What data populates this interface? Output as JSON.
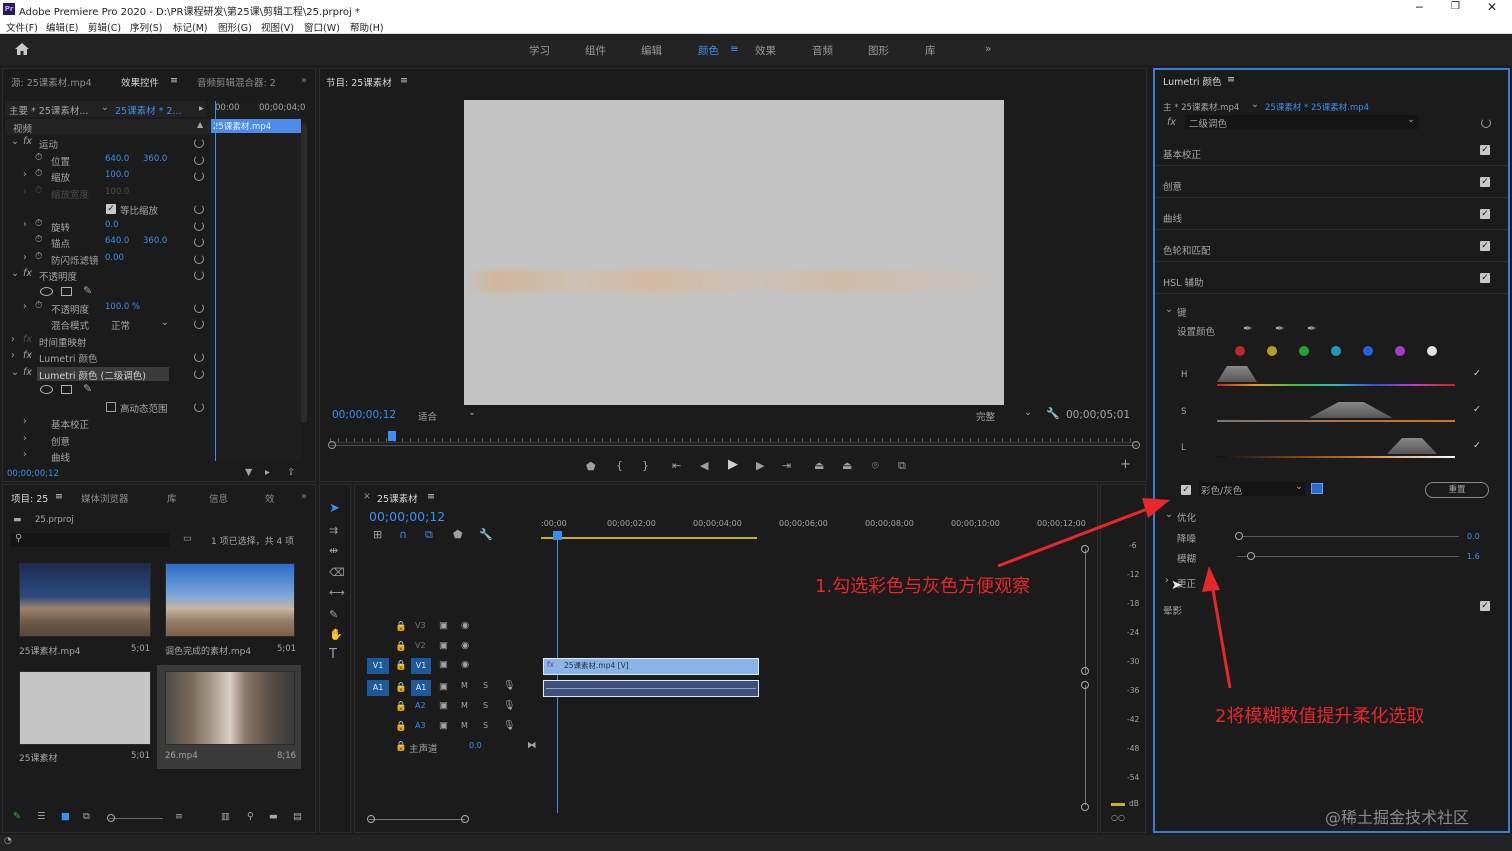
{
  "app": {
    "title": "Adobe Premiere Pro 2020 - D:\\PR课程研发\\第25课\\剪辑工程\\25.prproj *",
    "logo": "Pr"
  },
  "menu": [
    "文件(F)",
    "编辑(E)",
    "剪辑(C)",
    "序列(S)",
    "标记(M)",
    "图形(G)",
    "视图(V)",
    "窗口(W)",
    "帮助(H)"
  ],
  "workspaces": [
    "学习",
    "组件",
    "编辑",
    "颜色",
    "效果",
    "音频",
    "图形",
    "库"
  ],
  "active_workspace": "颜色",
  "effect_controls": {
    "tabs": [
      "源: 25课素材.mp4",
      "效果控件",
      "音频剪辑混合器: 2"
    ],
    "master": "主要 * 25课素材...",
    "clip": "25课素材 * 2...",
    "tc_start": "00:00",
    "tc_end": "00;00;04;0",
    "clip_label": "25课素材.mp4",
    "section_video": "视频",
    "motion": "运动",
    "position": "位置",
    "pos_x": "640.0",
    "pos_y": "360.0",
    "scale": "缩放",
    "scale_val": "100.0",
    "scale_w": "缩放宽度",
    "scale_w_val": "100.0",
    "uniform": "等比缩放",
    "rotation": "旋转",
    "rotation_val": "0.0",
    "anchor": "锚点",
    "anchor_x": "640.0",
    "anchor_y": "360.0",
    "antiflicker": "防闪烁滤镜",
    "antiflicker_val": "0.00",
    "opacity_group": "不透明度",
    "opacity": "不透明度",
    "opacity_val": "100.0 %",
    "blend": "混合模式",
    "blend_val": "正常",
    "time_remap": "时间重映射",
    "lumetri1": "Lumetri 颜色",
    "lumetri2": "Lumetri 颜色 (二级调色)",
    "hdr": "高动态范围",
    "basic": "基本校正",
    "creative": "创意",
    "curves": "曲线",
    "tc_bottom": "00;00;00;12"
  },
  "program": {
    "title": "节目: 25课素材",
    "timecode": "00;00;00;12",
    "fit": "适合",
    "quality": "完整",
    "duration": "00;00;05;01"
  },
  "project": {
    "tabs": [
      "项目: 25",
      "媒体浏览器",
      "库",
      "信息",
      "效"
    ],
    "file": "25.prproj",
    "selection": "1 项已选择，共 4 项",
    "items": [
      {
        "name": "25课素材.mp4",
        "dur": "5;01"
      },
      {
        "name": "调色完成的素材.mp4",
        "dur": "5;01"
      },
      {
        "name": "25课素材",
        "dur": "5;01"
      },
      {
        "name": "26.mp4",
        "dur": "8;16"
      }
    ]
  },
  "timeline": {
    "title": "25课素材",
    "timecode": "00;00;00;12",
    "ruler": [
      ":00;00",
      "00;00;02;00",
      "00;00;04;00",
      "00;00;06;00",
      "00;00;08;00",
      "00;00;10;00",
      "00;00;12;00"
    ],
    "video_tracks": [
      "V3",
      "V2",
      "V1"
    ],
    "audio_tracks": [
      "A1",
      "A2",
      "A3"
    ],
    "master": "主声道",
    "master_val": "0.0",
    "clip_video": "25课素材.mp4 [V]",
    "meter_scale": [
      "-6",
      "-12",
      "-18",
      "-24",
      "-30",
      "-36",
      "-42",
      "-48",
      "-54",
      "dB"
    ]
  },
  "lumetri": {
    "title": "Lumetri 颜色",
    "master": "主 * 25课素材.mp4",
    "clip": "25课素材 * 25课素材.mp4",
    "fx_name": "二级调色",
    "sections": [
      "基本校正",
      "创意",
      "曲线",
      "色轮和匹配",
      "HSL 辅助"
    ],
    "key": "键",
    "set_color": "设置颜色",
    "h": "H",
    "s": "S",
    "l": "L",
    "color_gray": "彩色/灰色",
    "reset": "重置",
    "refine": "优化",
    "denoise": "降噪",
    "denoise_val": "0.0",
    "blur": "模糊",
    "blur_val": "1.6",
    "correction": "更正",
    "vignette": "晕影",
    "swatch_colors": [
      "#c0262a",
      "#b5a01e",
      "#25a33a",
      "#1f9bb5",
      "#2a5ee6",
      "#a13fc0",
      "#e0e0e0"
    ]
  },
  "annotations": {
    "a1": "1.勾选彩色与灰色方便观察",
    "a2": "2将模糊数值提升柔化选取",
    "color": "#e8272a"
  },
  "watermark": "@稀土掘金技术社区"
}
